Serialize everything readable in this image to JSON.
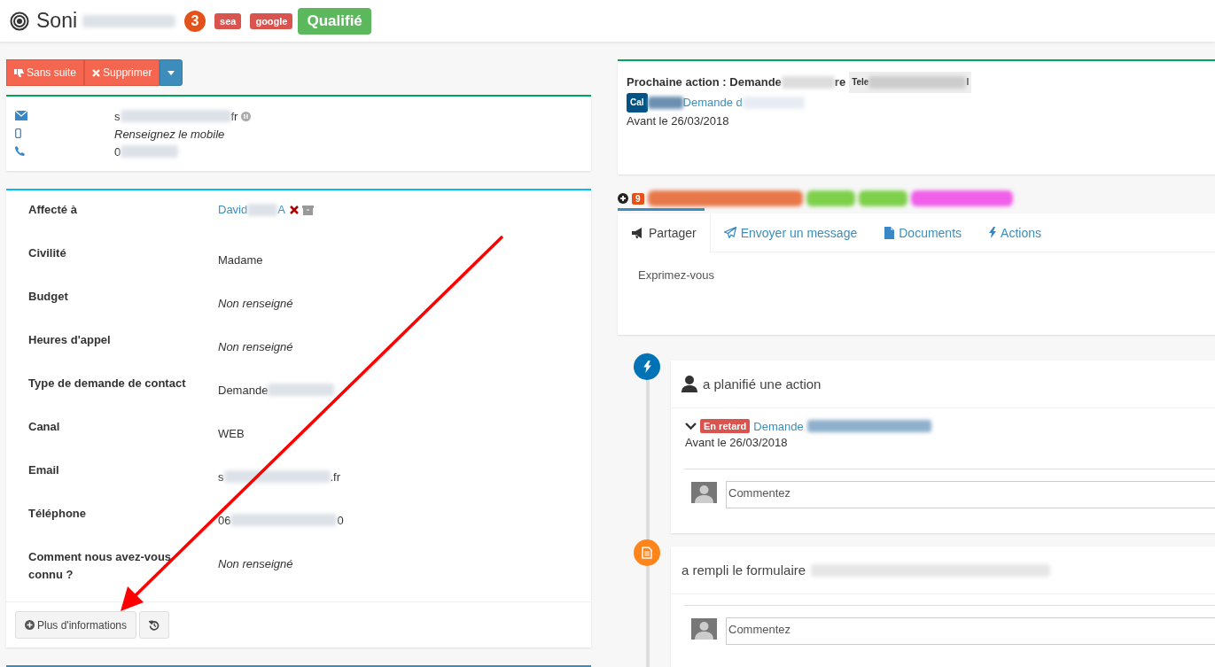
{
  "header": {
    "name": "Soni",
    "count": "3",
    "tags": [
      {
        "label": "sea",
        "color": "#d9534f"
      },
      {
        "label": "google",
        "color": "#d9534f"
      }
    ],
    "status": "Qualifié"
  },
  "action_buttons": [
    "Sans suite",
    "Supprimer"
  ],
  "contact": [
    {
      "kind": "email",
      "text": "s",
      "suffix": "fr"
    },
    {
      "kind": "mobile",
      "placeholder": "Renseignez le mobile"
    },
    {
      "kind": "phone",
      "text": "0"
    }
  ],
  "fields": [
    {
      "label": "Affecté à",
      "value": "David",
      "suffix": "A",
      "kind": "user"
    },
    {
      "label": "Civilité",
      "value": "Madame",
      "kind": "text"
    },
    {
      "label": "Budget",
      "value": "Non renseigné",
      "kind": "placeholder"
    },
    {
      "label": "Heures d'appel",
      "value": "Non renseigné",
      "kind": "placeholder"
    },
    {
      "label": "Type de demande de contact",
      "value": "Demande",
      "kind": "masked"
    },
    {
      "label": "Canal",
      "value": "WEB",
      "kind": "text"
    },
    {
      "label": "Email",
      "value": "s",
      "suffix": ".fr",
      "kind": "masked"
    },
    {
      "label": "Téléphone",
      "value": "06",
      "suffix": "0",
      "kind": "masked"
    },
    {
      "label": "Comment nous avez-vous connu ?",
      "value": "Non renseigné",
      "kind": "placeholder"
    }
  ],
  "more_button": "Plus d'informations",
  "next_action": {
    "title": "Prochaine action : Demande",
    "title_end": "re",
    "type_badge": "Tele",
    "type_badge_end": "l",
    "category_badge": "Cal",
    "link": "Demande d",
    "due": "Avant le 26/03/2018"
  },
  "tag_bar": {
    "count_badge": "9",
    "tags": [
      {
        "color": "#e8784a"
      },
      {
        "color": "#7ed04b"
      },
      {
        "color": "#7ed04b"
      },
      {
        "color": "#ef5fe8"
      }
    ]
  },
  "tabs": [
    {
      "label": "Partager",
      "selected": true
    },
    {
      "label": "Envoyer un message",
      "selected": false
    },
    {
      "label": "Documents",
      "selected": false
    },
    {
      "label": "Actions",
      "selected": false
    }
  ],
  "composer": {
    "placeholder": "Exprimez-vous"
  },
  "timeline": [
    {
      "kind": "action",
      "title": "a planifié une action",
      "task": {
        "status": "En retard",
        "link": "Demande",
        "due": "Avant le 26/03/2018"
      },
      "comment_placeholder": "Commentez"
    },
    {
      "kind": "form",
      "title": "a rempli le formulaire",
      "comment_placeholder": "Commentez"
    }
  ]
}
